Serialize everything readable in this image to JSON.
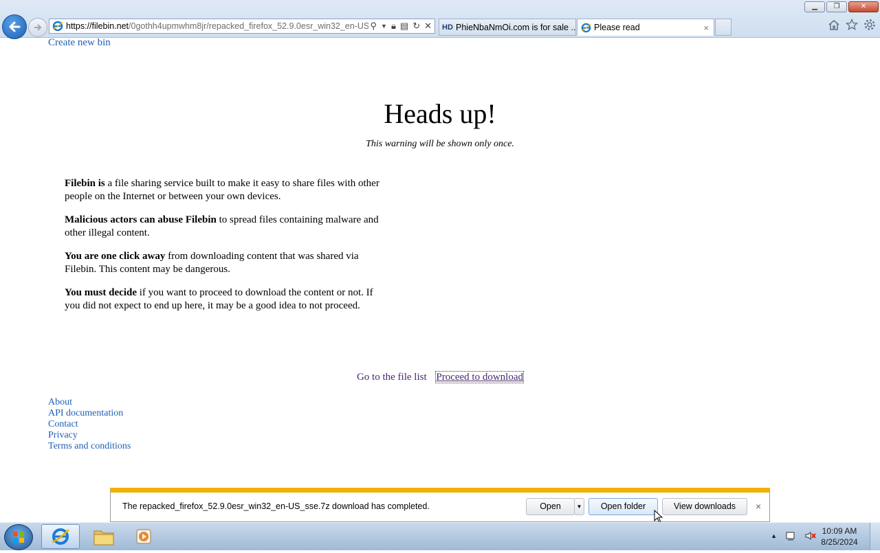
{
  "browser": {
    "address": {
      "host": "https://filebin.net",
      "path": "/0gothh4upmwhm8jr/repacked_firefox_52.9.0esr_win32_en-US_ss"
    },
    "tabs": [
      {
        "badge": "HD",
        "label": "PhieNbaNmOi.com is for sale ..."
      },
      {
        "label": "Please read",
        "close": "×"
      }
    ]
  },
  "page": {
    "create_link": "Create new bin",
    "title": "Heads up!",
    "subtitle": "This warning will be shown only once.",
    "paragraphs": [
      {
        "bold": "Filebin is",
        "text": " a file sharing service built to make it easy to share files with other people on the Internet or between your own devices."
      },
      {
        "bold": "Malicious actors can abuse Filebin",
        "text": " to spread files containing malware and other illegal content."
      },
      {
        "bold": "You are one click away",
        "text": " from downloading content that was shared via Filebin. This content may be dangerous."
      },
      {
        "bold": "You must decide",
        "text": " if you want to proceed to download the content or not. If you did not expect to end up here, it may be a good idea to not proceed."
      }
    ],
    "actions": {
      "file_list": "Go to the file list",
      "proceed": "Proceed to download"
    },
    "footer": [
      "About",
      "API documentation",
      "Contact",
      "Privacy",
      "Terms and conditions"
    ]
  },
  "download_bar": {
    "message": "The repacked_firefox_52.9.0esr_win32_en-US_sse.7z download has completed.",
    "open": "Open",
    "open_folder": "Open folder",
    "view_downloads": "View downloads",
    "close": "×",
    "accent_color": "#efb200"
  },
  "taskbar": {
    "time": "10:09 AM",
    "date": "8/25/2024",
    "items": [
      "internet-explorer-icon",
      "file-explorer-icon",
      "media-player-icon"
    ]
  }
}
